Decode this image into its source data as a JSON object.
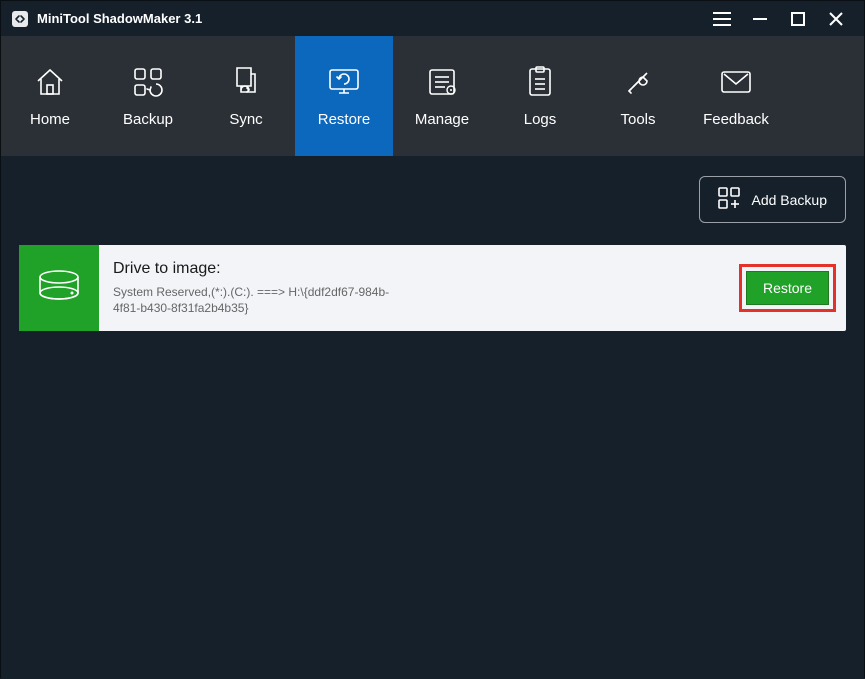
{
  "titlebar": {
    "app_title": "MiniTool ShadowMaker 3.1"
  },
  "nav": {
    "items": [
      {
        "label": "Home"
      },
      {
        "label": "Backup"
      },
      {
        "label": "Sync"
      },
      {
        "label": "Restore"
      },
      {
        "label": "Manage"
      },
      {
        "label": "Logs"
      },
      {
        "label": "Tools"
      },
      {
        "label": "Feedback"
      }
    ],
    "active_index": 3
  },
  "toolbar": {
    "add_backup_label": "Add Backup"
  },
  "backup_card": {
    "title": "Drive to image:",
    "description": "System Reserved,(*:).(C:). ===> H:\\{ddf2df67-984b-4f81-b430-8f31fa2b4b35}",
    "restore_label": "Restore"
  },
  "colors": {
    "accent": "#0b68bd",
    "green": "#20a128",
    "highlight_border": "#e4322b",
    "bg_dark": "#16202b",
    "nav_bg": "#2b3037"
  }
}
